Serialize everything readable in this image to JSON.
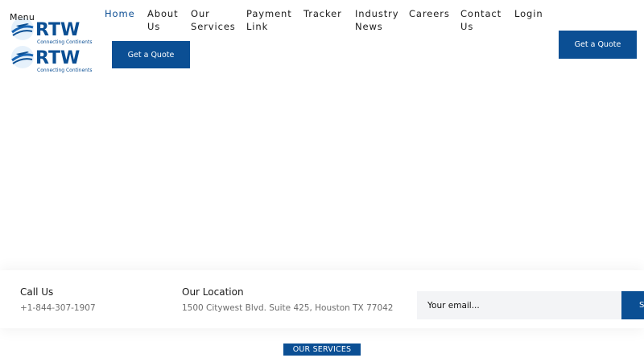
{
  "header": {
    "menu_label": "Menu",
    "logo": {
      "text": "RTW",
      "tagline": "Connecting Continents"
    },
    "nav": [
      {
        "label": "Home",
        "active": true
      },
      {
        "label": "About\nUs"
      },
      {
        "label": "Our\nServices"
      },
      {
        "label": "Payment\nLink"
      },
      {
        "label": "Tracker"
      },
      {
        "label": "Industry\nNews"
      },
      {
        "label": "Careers"
      },
      {
        "label": "Contact\nUs"
      },
      {
        "label": "Login"
      }
    ],
    "quote_button": "Get a Quote",
    "quote_button_secondary": "Get a Quote"
  },
  "contact": {
    "call_title": "Call Us",
    "call_value": "+1-844-307-1907",
    "location_title": "Our Location",
    "location_value": "1500 Citywest Blvd. Suite 425, Houston TX 77042",
    "email_placeholder": "Your email...",
    "subscribe_label": "S"
  },
  "section": {
    "badge": "OUR SERVICES"
  },
  "colors": {
    "brand": "#0b4f94",
    "nav_active": "#0d4e94",
    "input_bg": "#f3f4f6"
  }
}
